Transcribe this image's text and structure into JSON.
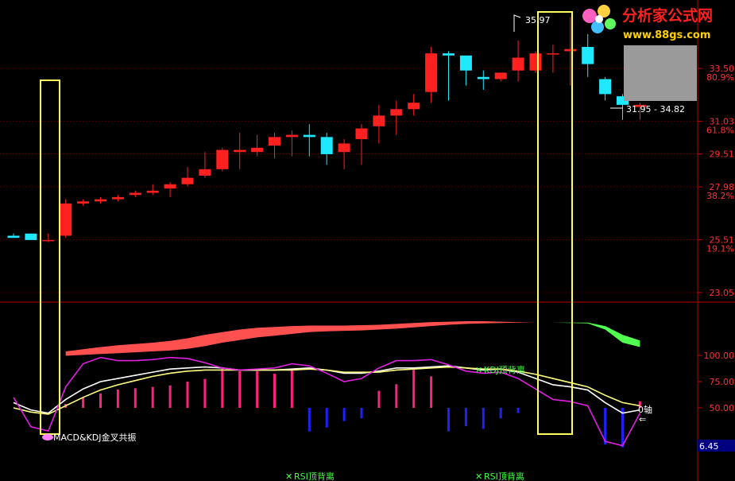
{
  "logo": {
    "cn_text": "分析家公式网",
    "url_text": "www.88gs.com"
  },
  "price_axis": {
    "ticks": [
      {
        "value": 33.5,
        "label": "33.50",
        "pct": "80.9%"
      },
      {
        "value": 31.03,
        "label": "31.03",
        "pct": "61.8%"
      },
      {
        "value": 29.51,
        "label": "29.51",
        "pct": ""
      },
      {
        "value": 27.98,
        "label": "27.98",
        "pct": "38.2%"
      },
      {
        "value": 25.51,
        "label": "25.51",
        "pct": "19.1%"
      },
      {
        "value": 23.05,
        "label": "23.05",
        "pct": ""
      }
    ]
  },
  "indicator_axis": {
    "ticks": [
      {
        "value": 100,
        "label": "100.00"
      },
      {
        "value": 75,
        "label": "75.00"
      },
      {
        "value": 50,
        "label": "50.00"
      }
    ],
    "readout_box": "6.45"
  },
  "annotations": {
    "high_label": "35.97",
    "range_label": "31.95 - 34.82",
    "macd_kdj_signal": "MACD&KDJ金叉共振",
    "kdj_divergence": "KDJ顶背离",
    "rsi_divergence_1": "RSI顶背离",
    "rsi_divergence_2": "RSI顶背离",
    "zero_axis": "0轴",
    "zero_axis_arrow": "⇐"
  },
  "colors": {
    "up": "#ff2020",
    "down": "#20e8ff",
    "k_line": "#ffffff",
    "d_line": "#ffff80",
    "j_line": "#e020e0",
    "band_bull": "#ff5050",
    "band_bear": "#50ff50",
    "macd_pos": "#ff2080",
    "macd_neg": "#2020ff",
    "highlight_box": "#ffff60",
    "divider": "#c00000"
  },
  "chart_data": [
    {
      "type": "candlestick",
      "x": [
        0,
        1,
        2,
        3,
        4,
        5,
        6,
        7,
        8,
        9,
        10,
        11,
        12,
        13,
        14,
        15,
        16,
        17,
        18,
        19,
        20,
        21,
        22,
        23,
        24,
        25,
        26,
        27,
        28,
        29,
        30,
        31,
        32,
        33,
        34,
        35,
        36
      ],
      "open": [
        25.7,
        25.8,
        25.5,
        25.7,
        27.2,
        27.3,
        27.4,
        27.6,
        27.7,
        27.9,
        28.1,
        28.5,
        28.8,
        29.6,
        29.6,
        29.9,
        30.3,
        30.4,
        30.3,
        29.6,
        30.2,
        30.8,
        31.3,
        31.6,
        32.4,
        34.2,
        34.1,
        33.1,
        33.0,
        33.4,
        33.4,
        34.2,
        34.3,
        34.5,
        33.0,
        32.2,
        31.7
      ],
      "high": [
        25.8,
        25.8,
        25.8,
        27.4,
        27.4,
        27.5,
        27.6,
        27.8,
        28.1,
        28.2,
        28.9,
        29.6,
        29.8,
        30.5,
        30.4,
        30.5,
        30.6,
        30.9,
        30.5,
        30.2,
        30.9,
        31.8,
        32.0,
        32.3,
        34.5,
        34.3,
        34.1,
        33.4,
        33.3,
        34.8,
        34.3,
        34.6,
        35.9,
        35.1,
        33.1,
        32.3,
        31.9
      ],
      "low": [
        25.6,
        25.5,
        25.4,
        25.6,
        27.1,
        27.2,
        27.3,
        27.5,
        27.6,
        27.5,
        28.0,
        28.4,
        28.7,
        28.8,
        29.4,
        29.3,
        29.4,
        29.4,
        29.0,
        28.8,
        29.0,
        30.0,
        30.4,
        31.3,
        31.9,
        32.0,
        32.7,
        32.5,
        32.9,
        32.9,
        33.3,
        33.3,
        32.7,
        33.1,
        32.0,
        31.1,
        31.1
      ],
      "close": [
        25.6,
        25.5,
        25.5,
        27.2,
        27.3,
        27.4,
        27.5,
        27.7,
        27.8,
        28.1,
        28.4,
        28.8,
        29.7,
        29.7,
        29.8,
        30.3,
        30.4,
        30.3,
        29.5,
        30.0,
        30.7,
        31.3,
        31.6,
        31.9,
        34.2,
        34.1,
        33.4,
        33.0,
        33.3,
        34.0,
        34.2,
        34.2,
        34.4,
        33.7,
        32.3,
        31.8,
        31.8
      ]
    },
    {
      "type": "area",
      "name": "",
      "x": [
        0,
        1,
        2,
        3,
        4,
        5,
        6,
        7,
        8,
        9,
        10,
        11,
        12,
        13,
        14,
        15,
        16,
        17,
        18,
        19,
        20,
        21,
        22,
        23,
        24,
        25,
        26,
        27,
        28,
        29,
        30,
        31,
        32,
        33,
        34,
        35,
        36
      ],
      "upper": [
        30,
        28,
        26,
        60,
        65,
        70,
        74,
        77,
        80,
        84,
        90,
        98,
        104,
        110,
        114,
        116,
        118,
        119,
        119,
        119,
        120,
        121,
        123,
        125,
        127,
        128,
        129,
        129,
        128,
        127,
        126,
        126,
        126,
        126,
        118,
        98,
        85
      ],
      "lower": [
        30,
        28,
        26,
        50,
        52,
        54,
        56,
        58,
        60,
        62,
        66,
        72,
        80,
        86,
        92,
        96,
        100,
        104,
        106,
        107,
        108,
        110,
        112,
        115,
        118,
        121,
        123,
        124,
        125,
        126,
        126,
        126,
        125,
        124,
        110,
        80,
        70
      ]
    },
    {
      "type": "line",
      "series": [
        {
          "name": "K",
          "values": [
            55,
            48,
            45,
            58,
            68,
            75,
            78,
            81,
            84,
            87,
            88,
            89,
            88,
            86,
            86,
            86,
            87,
            88,
            86,
            83,
            83,
            85,
            88,
            88,
            89,
            90,
            88,
            86,
            87,
            84,
            78,
            72,
            70,
            67,
            55,
            45,
            48
          ]
        },
        {
          "name": "D",
          "values": [
            50,
            46,
            44,
            52,
            60,
            67,
            72,
            76,
            80,
            83,
            85,
            86,
            86,
            86,
            86,
            86,
            86,
            87,
            86,
            84,
            84,
            84,
            86,
            87,
            88,
            89,
            88,
            87,
            87,
            85,
            82,
            78,
            74,
            70,
            62,
            55,
            52
          ]
        },
        {
          "name": "J",
          "values": [
            60,
            32,
            28,
            70,
            92,
            98,
            95,
            95,
            96,
            98,
            97,
            93,
            88,
            86,
            87,
            88,
            92,
            90,
            83,
            75,
            78,
            88,
            95,
            95,
            96,
            91,
            85,
            83,
            84,
            78,
            68,
            58,
            56,
            52,
            18,
            14,
            45
          ]
        }
      ]
    },
    {
      "type": "bar",
      "name": "",
      "x": [
        0,
        1,
        2,
        3,
        4,
        5,
        6,
        7,
        8,
        9,
        10,
        11,
        12,
        13,
        14,
        15,
        16,
        17,
        18,
        19,
        20,
        21,
        22,
        23,
        24,
        25,
        26,
        27,
        28,
        29,
        30,
        31,
        32,
        33,
        34,
        35,
        36
      ],
      "values": [
        0,
        0,
        0,
        3,
        8,
        11,
        14,
        15,
        16,
        17,
        20,
        22,
        30,
        28,
        28,
        26,
        30,
        -18,
        -15,
        -10,
        -8,
        13,
        18,
        30,
        24,
        -18,
        -14,
        -16,
        -8,
        -4,
        0,
        0,
        0,
        0,
        -28,
        -30,
        5
      ]
    }
  ]
}
